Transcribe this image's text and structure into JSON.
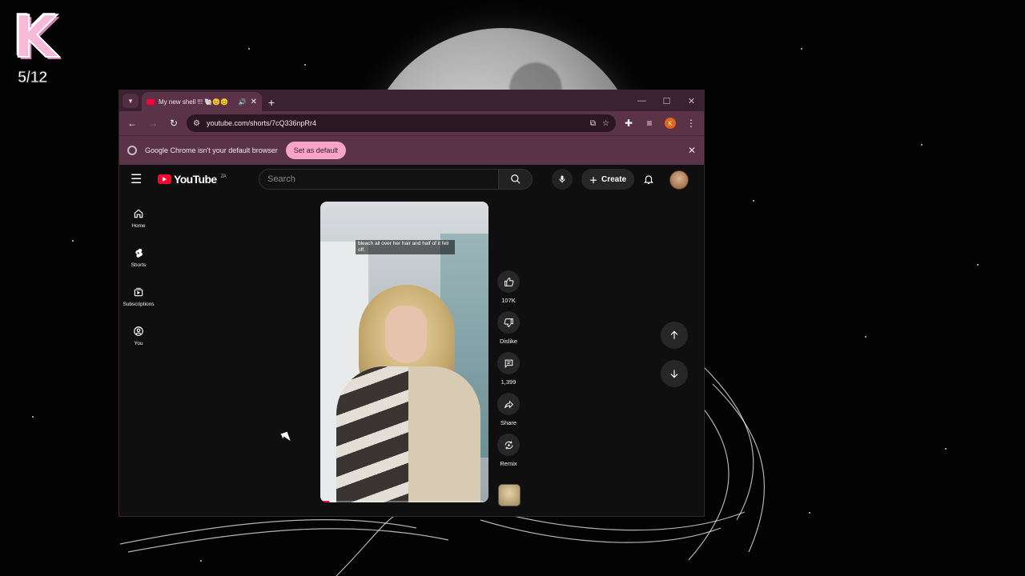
{
  "overlay": {
    "counter": "5/12",
    "logo_letter": "K"
  },
  "browser": {
    "tab_title": "My new shell !!! 🐚😊😊",
    "new_tab_label": "+",
    "url": "youtube.com/shorts/7cQ336npRr4",
    "profile_initial": "K",
    "infobar_text": "Google Chrome isn't your default browser",
    "infobar_button": "Set as default",
    "accent": "#5a3347"
  },
  "youtube": {
    "logo_text": "YouTube",
    "region": "ZA",
    "search_placeholder": "Search",
    "create_label": "Create",
    "sidebar": [
      {
        "label": "Home",
        "icon": "home-icon"
      },
      {
        "label": "Shorts",
        "icon": "shorts-icon"
      },
      {
        "label": "Subscriptions",
        "icon": "subscriptions-icon"
      },
      {
        "label": "You",
        "icon": "you-icon"
      }
    ],
    "short": {
      "caption": "bleach all over her hair and half of it fell off.",
      "progress": 0.05
    },
    "actions": {
      "like": "107K",
      "dislike": "Dislike",
      "comments": "1,399",
      "share": "Share",
      "remix": "Remix"
    }
  }
}
